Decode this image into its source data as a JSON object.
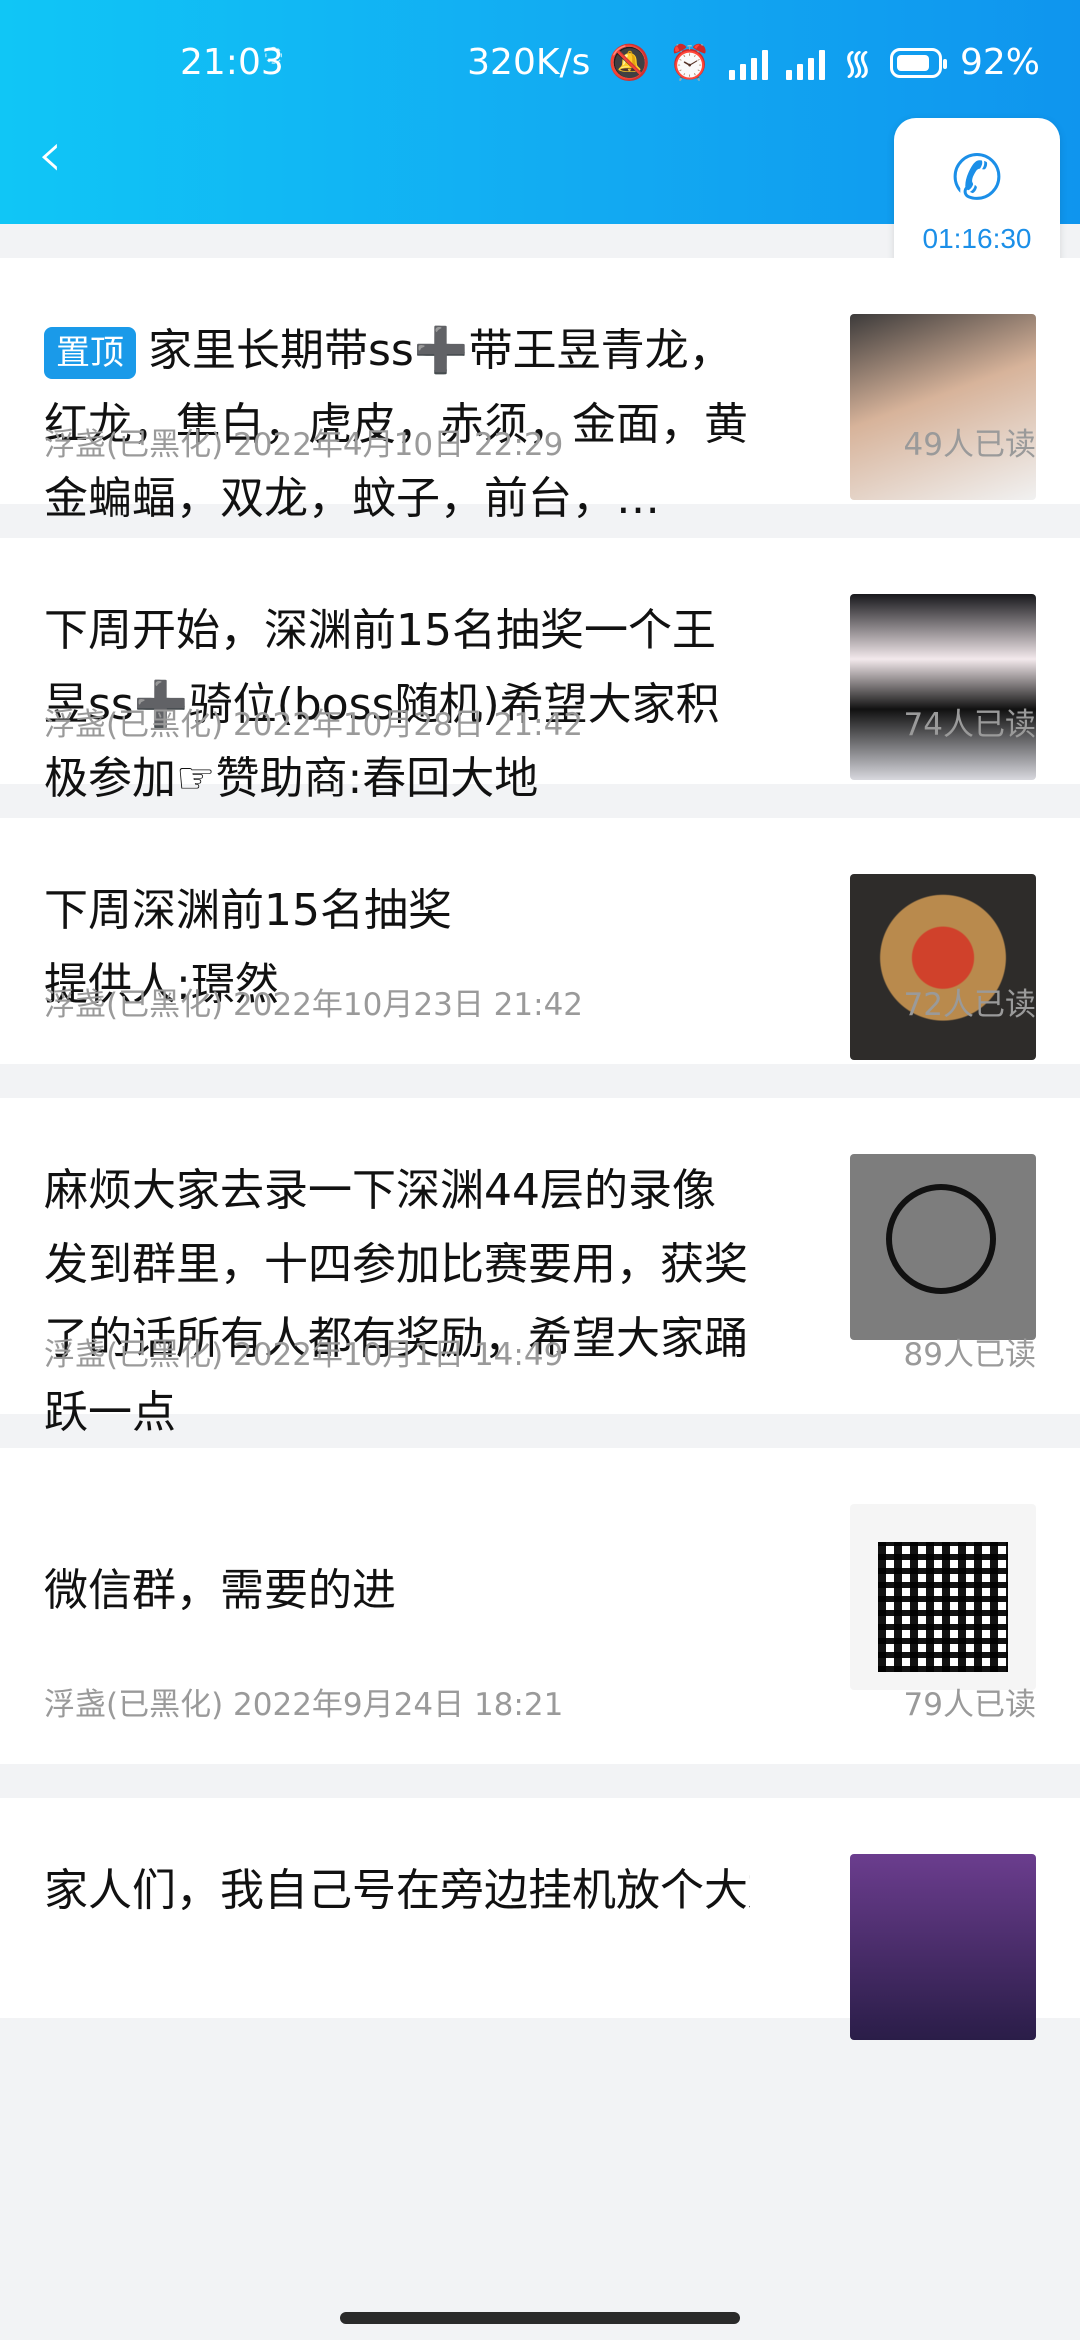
{
  "status_bar": {
    "time": "21:03",
    "speed": "320K/s",
    "battery": "92%"
  },
  "call": {
    "duration": "01:16:30"
  },
  "pin_label": "置顶",
  "posts": [
    {
      "text": "家里长期带ss➕带王昱青龙，红龙，隼白，虎皮，赤须，金面，黄金蝙蝠，双龙，蚊子，前台，…",
      "pinned": true,
      "author_date": "浮盏(已黑化) 2022年4月10日 22:29",
      "reads": "49人已读",
      "thumb": "photo"
    },
    {
      "text": "下周开始，深渊前15名抽奖一个王昱ss➕骑位(boss随机)希望大家积极参加☞赞助商:春回大地",
      "pinned": false,
      "author_date": "浮盏(已黑化) 2022年10月28日 21:42",
      "reads": "74人已读",
      "thumb": "photo"
    },
    {
      "text": "下周深渊前15名抽奖\n提供人:璟然",
      "pinned": false,
      "author_date": "浮盏(已黑化) 2022年10月23日 21:42",
      "reads": "72人已读",
      "thumb": "photo"
    },
    {
      "text": "麻烦大家去录一下深渊44层的录像发到群里，十四参加比赛要用，获奖了的话所有人都有奖励，希望大家踊跃一点",
      "pinned": false,
      "author_date": "浮盏(已黑化) 2022年10月1日 14:49",
      "reads": "89人已读",
      "thumb": "sticker"
    },
    {
      "text": "微信群，需要的进",
      "pinned": false,
      "author_date": "浮盏(已黑化) 2022年9月24日 18:21",
      "reads": "79人已读",
      "thumb": "qr-code"
    },
    {
      "text": "家人们，我自己号在旁边挂机放个大放个",
      "pinned": false,
      "author_date": "",
      "reads": "",
      "thumb": "screenshot"
    }
  ],
  "icons": {
    "back": "chevron-left-icon",
    "phone": "phone-icon",
    "mute": "bell-off-icon",
    "alarm": "alarm-icon",
    "wifi": "wifi-icon"
  },
  "colors": {
    "header_start": "#10c6f6",
    "header_end": "#0f95ee",
    "accent": "#1a9ae9"
  }
}
